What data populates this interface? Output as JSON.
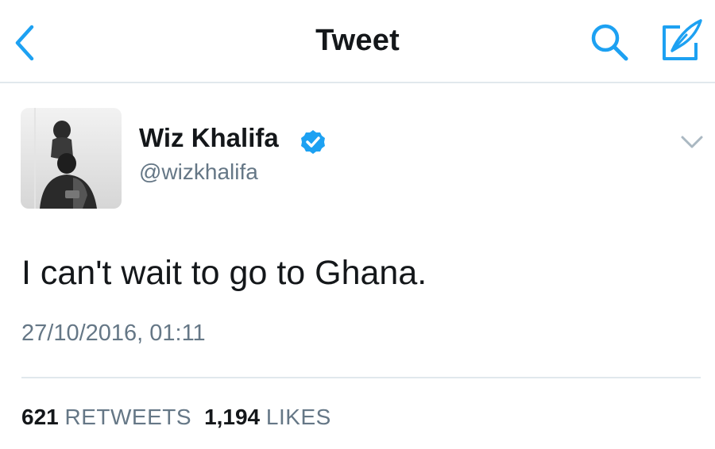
{
  "header": {
    "title": "Tweet",
    "back_icon": "chevron-left-icon",
    "search_icon": "search-icon",
    "compose_icon": "compose-tweet-icon"
  },
  "tweet": {
    "author": {
      "display_name": "Wiz Khalifa",
      "handle": "@wizkhalifa",
      "verified": true,
      "verified_icon": "verified-badge-icon"
    },
    "menu_icon": "chevron-down-icon",
    "text": "I can't wait to go to Ghana.",
    "timestamp": "27/10/2016, 01:11",
    "stats": {
      "retweets_count": "621",
      "retweets_label": "RETWEETS",
      "likes_count": "1,194",
      "likes_label": "LIKES"
    }
  },
  "colors": {
    "accent": "#1da1f2",
    "text_primary": "#14171a",
    "text_secondary": "#657786",
    "divider": "#e1e8ed"
  }
}
